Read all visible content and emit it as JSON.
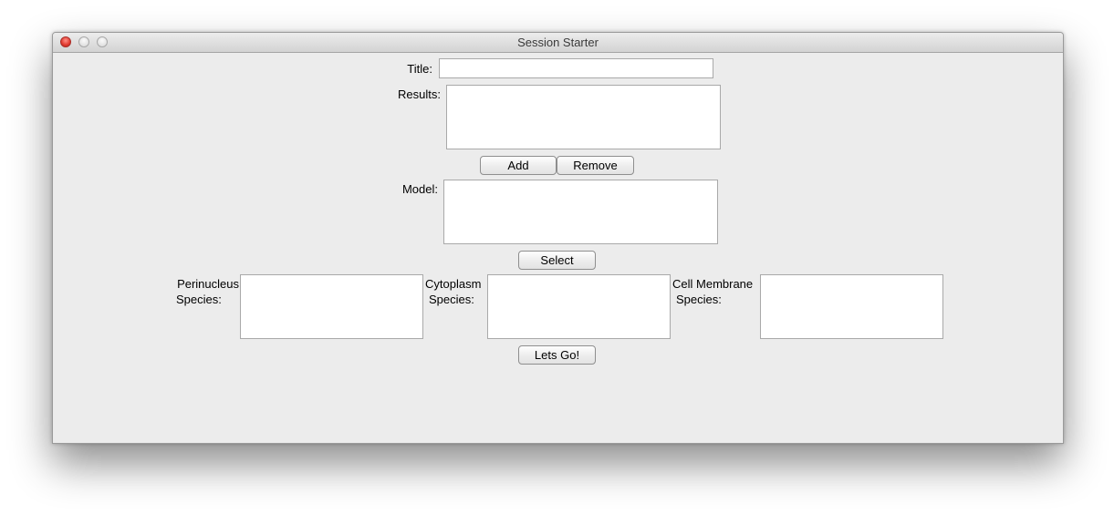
{
  "window": {
    "title": "Session Starter"
  },
  "form": {
    "title_label": "Title:",
    "title_value": "",
    "results_label": "Results:",
    "results_value": "",
    "add_label": "Add",
    "remove_label": "Remove",
    "model_label": "Model:",
    "model_value": "",
    "select_label": "Select",
    "perinucleus_label_line1": "Perinucleus",
    "perinucleus_label_line2": "Species:",
    "cytoplasm_label_line1": "Cytoplasm",
    "cytoplasm_label_line2": "Species:",
    "membrane_label_line1": "Cell Membrane",
    "membrane_label_line2": "Species:",
    "go_label": "Lets Go!"
  }
}
